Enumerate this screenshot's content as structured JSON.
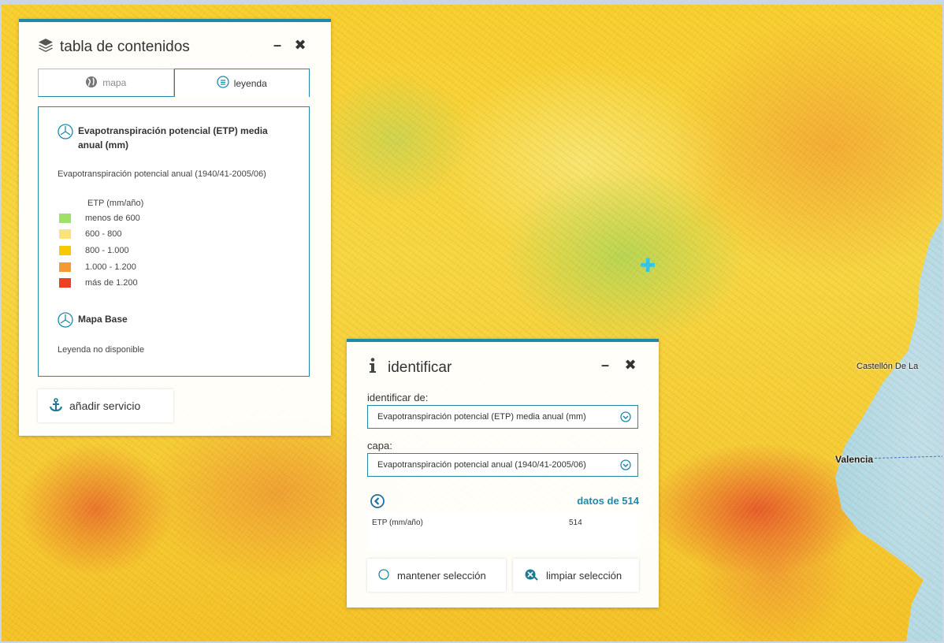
{
  "map": {
    "places": {
      "castellon": "Castellón De La",
      "valencia": "Valencia"
    },
    "crosshair_icon": "crosshair-plus-icon"
  },
  "toc": {
    "title": "tabla de contenidos",
    "tabs": [
      {
        "label": "mapa",
        "icon": "globe-icon"
      },
      {
        "label": "leyenda",
        "icon": "list-icon"
      }
    ],
    "active_tab": "leyenda",
    "layers": [
      {
        "name": "Evapotranspiración potencial (ETP) media anual (mm)",
        "subtitle": "Evapotranspiración potencial anual (1940/41-2005/06)",
        "unit": "ETP (mm/año)",
        "items": [
          {
            "label": "menos de 600",
            "color": "#9fe066"
          },
          {
            "label": "600 - 800",
            "color": "#fce27a"
          },
          {
            "label": "800 - 1.000",
            "color": "#f7c900"
          },
          {
            "label": "1.000 - 1.200",
            "color": "#f49a34"
          },
          {
            "label": "más de 1.200",
            "color": "#ee3e23"
          }
        ]
      },
      {
        "name": "Mapa Base",
        "note": "Leyenda no disponible"
      }
    ],
    "add_service_label": "añadir servicio"
  },
  "identify": {
    "title": "identificar",
    "from_label": "identificar de:",
    "from_value": "Evapotranspiración potencial (ETP) media anual (mm)",
    "layer_label": "capa:",
    "layer_value": "Evapotranspiración potencial anual (1940/41-2005/06)",
    "data_title": "datos de 514",
    "result": {
      "key": "ETP (mm/año)",
      "value": "514"
    },
    "keep_label": "mantener selección",
    "clear_label": "limpiar selección"
  },
  "colors": {
    "accent": "#1e8aa8"
  }
}
